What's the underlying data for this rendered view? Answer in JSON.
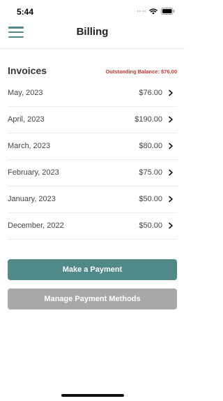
{
  "status_bar": {
    "time": "5:44"
  },
  "nav": {
    "title": "Billing"
  },
  "invoices": {
    "heading": "Invoices",
    "outstanding_balance": "Outstanding Balance: $76.00",
    "items": [
      {
        "date": "May, 2023",
        "amount": "$76.00"
      },
      {
        "date": "April, 2023",
        "amount": "$190.00"
      },
      {
        "date": "March, 2023",
        "amount": "$80.00"
      },
      {
        "date": "February, 2023",
        "amount": "$75.00"
      },
      {
        "date": "January, 2023",
        "amount": "$50.00"
      },
      {
        "date": "December, 2022",
        "amount": "$50.00"
      }
    ]
  },
  "actions": {
    "make_payment": "Make a Payment",
    "manage_methods": "Manage Payment Methods"
  },
  "colors": {
    "accent": "#4f8a88",
    "balance_red": "#c0392b",
    "disabled_button": "#a8a8a8"
  },
  "icons": {
    "menu": "hamburger-menu-icon",
    "row": "chevron-right-icon",
    "wifi": "wifi-icon",
    "battery": "battery-icon",
    "signal": "signal-icon"
  }
}
